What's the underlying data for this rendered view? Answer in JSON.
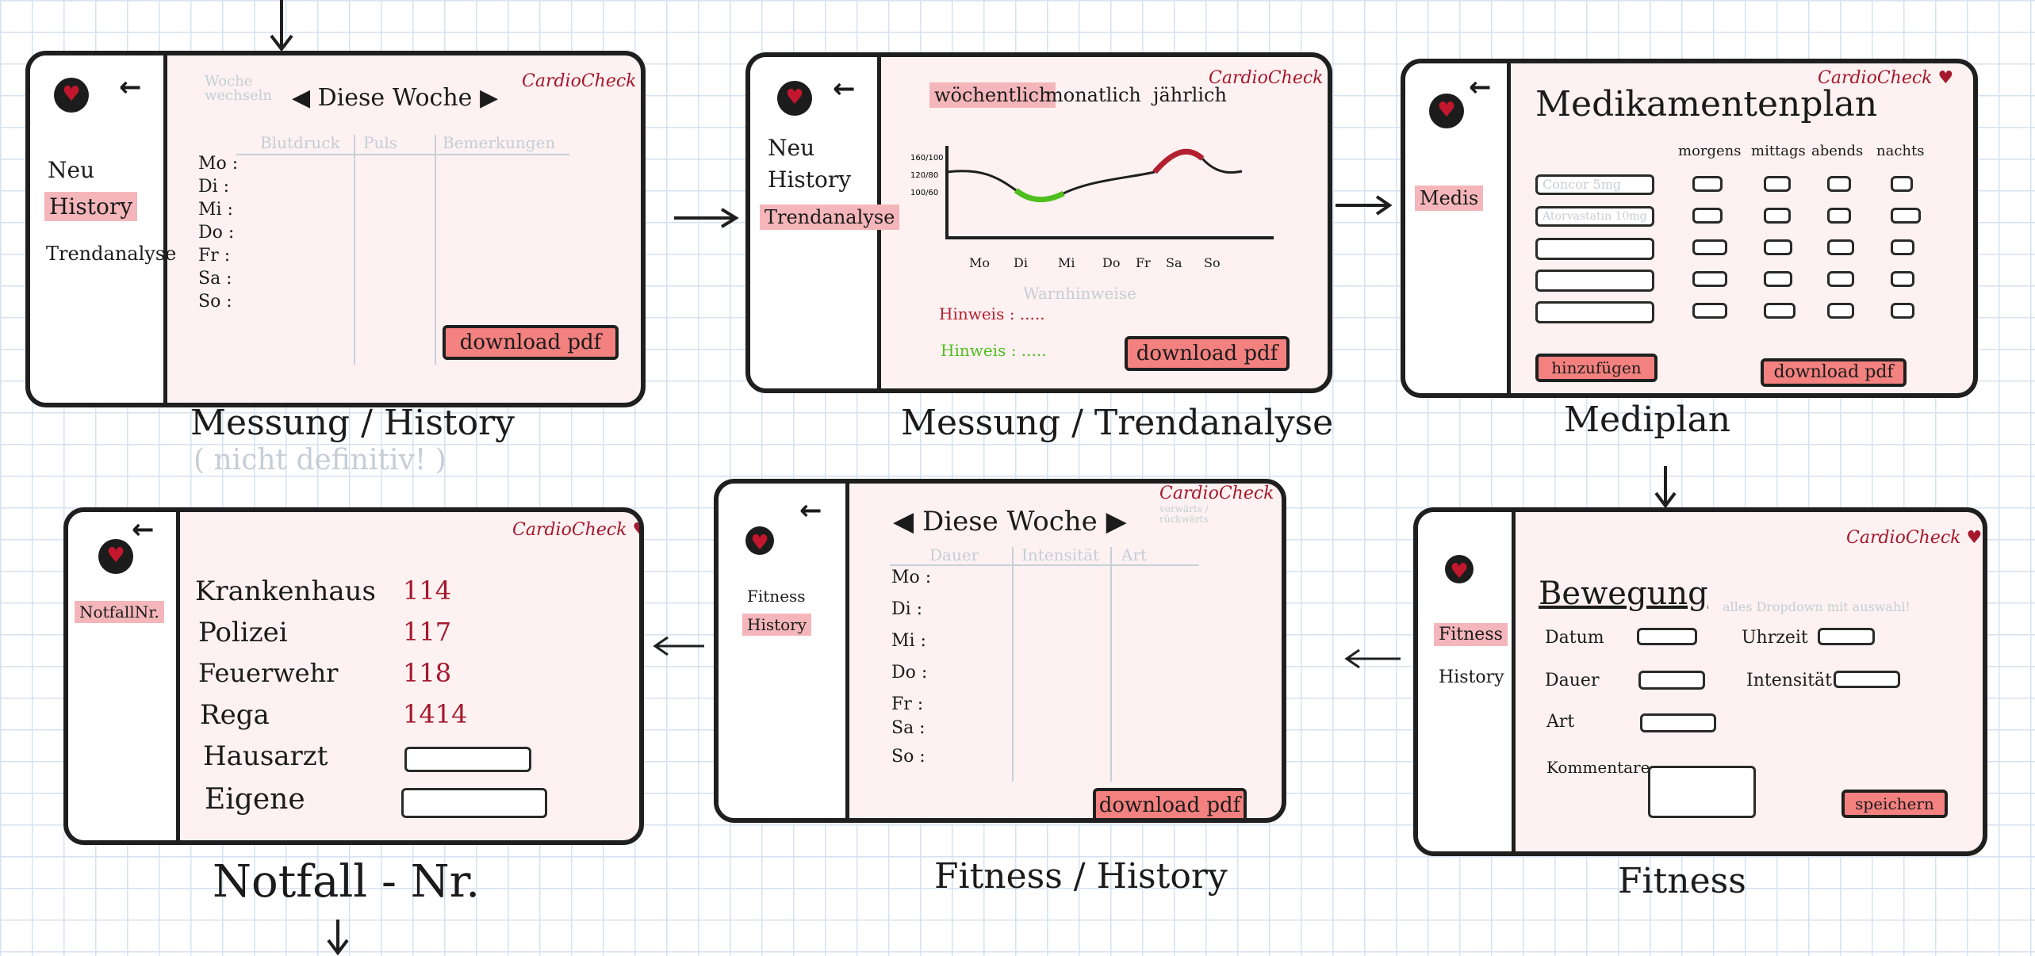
{
  "brand": "CardioCheck",
  "screens": {
    "history": {
      "caption": "Messung / History",
      "note": "( nicht definitiv! )",
      "hint": "Woche wechseln",
      "week": "Diese Woche",
      "columns": [
        "Blutdruck",
        "Puls",
        "Bemerkungen"
      ],
      "days": [
        "Mo :",
        "Di :",
        "Mi :",
        "Do :",
        "Fr :",
        "Sa :",
        "So :"
      ],
      "nav": [
        "Neu",
        "History",
        "Trendanalyse"
      ],
      "pdf": "download pdf"
    },
    "trend": {
      "caption": "Messung / Trendanalyse",
      "tabs": [
        "wöchentlich",
        "monatlich",
        "jährlich"
      ],
      "nav": [
        "Neu",
        "History",
        "Trendanalyse"
      ],
      "x_labels": [
        "Mo",
        "Di",
        "Mi",
        "Do",
        "Fr",
        "Sa",
        "So"
      ],
      "y_labels": [
        "160/100",
        "120/80",
        "100/60"
      ],
      "warn_label": "Warnhinweise",
      "hint1": "Hinweis :",
      "hint1_val": ".....",
      "hint2": "Hinweis :",
      "hint2_val": ".....",
      "pdf": "download pdf"
    },
    "mediplan": {
      "caption": "Mediplan",
      "title": "Medikamentenplan",
      "cols": [
        "morgens",
        "mittags",
        "abends",
        "nachts"
      ],
      "meds": [
        "Concor 5mg",
        "Atorvastatin 10mg",
        "",
        "",
        ""
      ],
      "nav": [
        "Medis"
      ],
      "add": "hinzufügen",
      "pdf": "download pdf"
    },
    "notfall": {
      "caption": "Notfall - Nr.",
      "nav": [
        "NotfallNr."
      ],
      "entries": [
        {
          "label": "Krankenhaus",
          "number": "114"
        },
        {
          "label": "Polizei",
          "number": "117"
        },
        {
          "label": "Feuerwehr",
          "number": "118"
        },
        {
          "label": "Rega",
          "number": "1414"
        }
      ],
      "hausarzt": "Hausarzt",
      "eigene": "Eigene"
    },
    "fitness_history": {
      "caption": "Fitness / History",
      "week": "Diese Woche",
      "hint": "vorwärts / rückwärts",
      "columns": [
        "Dauer",
        "Intensität",
        "Art"
      ],
      "days": [
        "Mo :",
        "Di :",
        "Mi :",
        "Do :",
        "Fr :",
        "Sa :",
        "So :"
      ],
      "nav": [
        "Fitness",
        "History"
      ],
      "pdf": "download pdf"
    },
    "fitness": {
      "caption": "Fitness",
      "title": "Bewegung",
      "hint": "alles Dropdown mit auswahl!",
      "fields": [
        "Datum",
        "Uhrzeit",
        "Dauer",
        "Intensität",
        "Art",
        "Kommentare"
      ],
      "nav": [
        "Fitness",
        "History"
      ],
      "save": "speichern"
    }
  },
  "colors": {
    "brand": "#a5182c",
    "accent": "#f3817f",
    "highlight": "#f4b6ba",
    "warn": "#b32030",
    "ok": "#4fbf1f"
  }
}
